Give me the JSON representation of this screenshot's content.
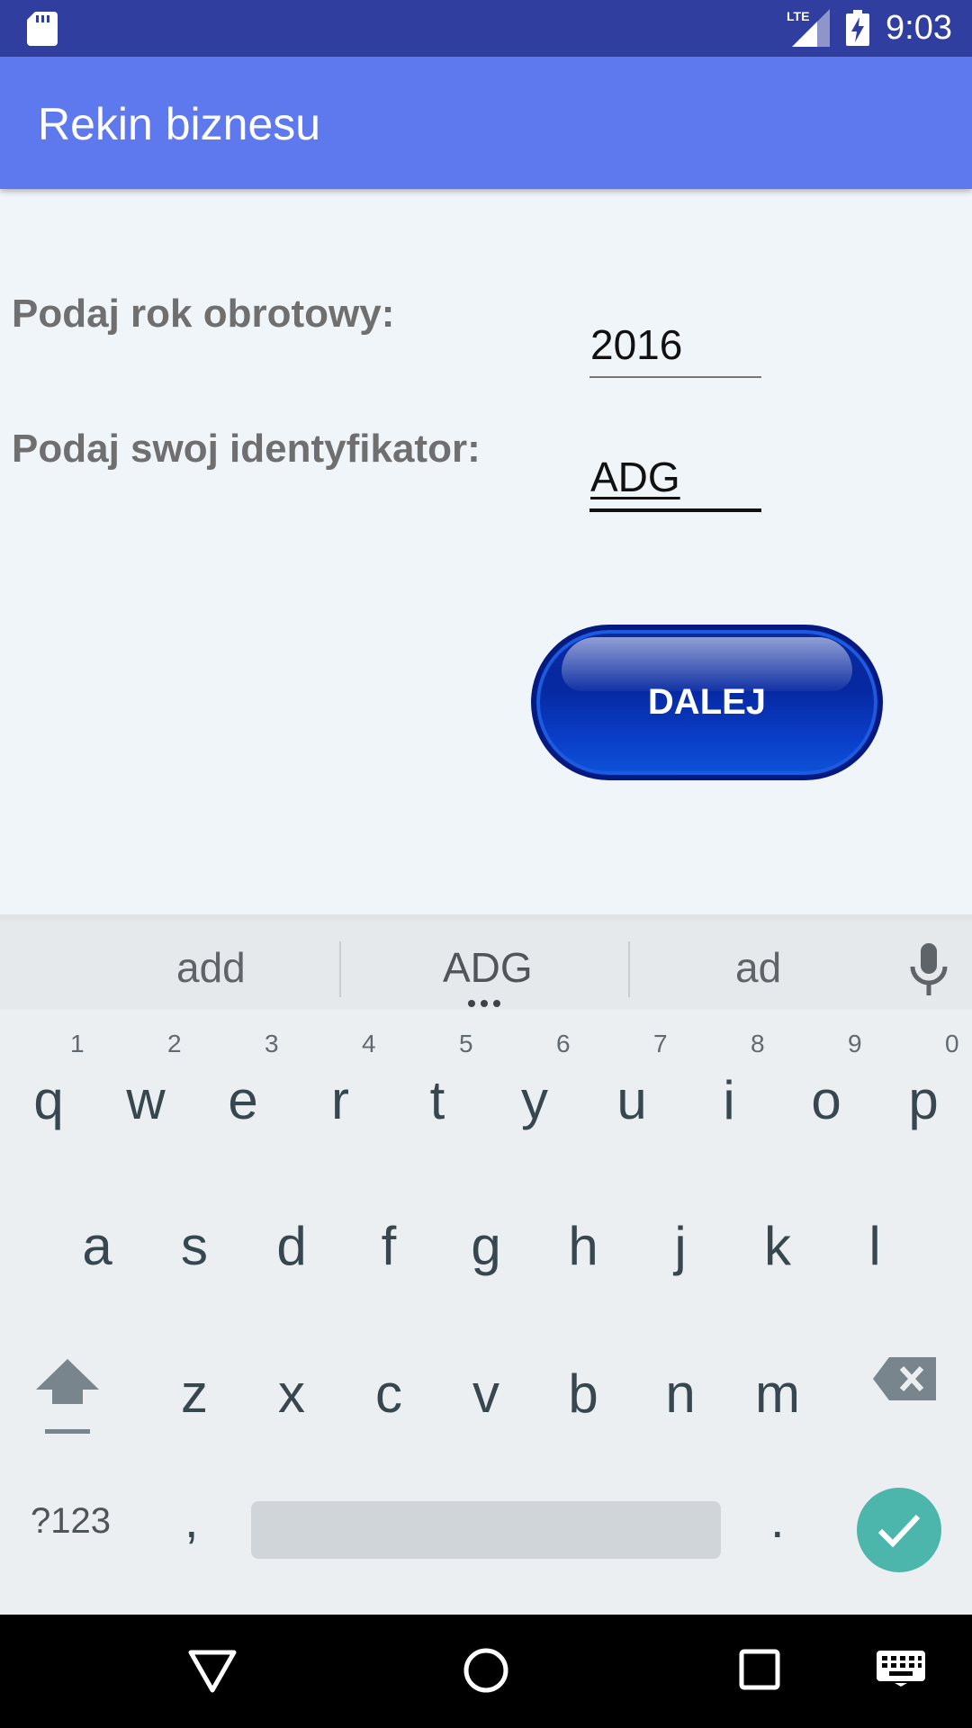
{
  "status_bar": {
    "time": "9:03",
    "network_label": "LTE",
    "icons": [
      "sd-card-icon",
      "lte-signal-icon",
      "battery-charging-icon"
    ]
  },
  "app_bar": {
    "title": "Rekin biznesu"
  },
  "form": {
    "year_label": "Podaj rok obrotowy:",
    "year_value": "2016",
    "id_label": "Podaj swoj identyfikator:",
    "id_value": "ADG",
    "next_button_label": "DALEJ"
  },
  "keyboard": {
    "suggestions": [
      "add",
      "ADG",
      "ad"
    ],
    "row1": [
      {
        "key": "q",
        "hint": "1"
      },
      {
        "key": "w",
        "hint": "2"
      },
      {
        "key": "e",
        "hint": "3"
      },
      {
        "key": "r",
        "hint": "4"
      },
      {
        "key": "t",
        "hint": "5"
      },
      {
        "key": "y",
        "hint": "6"
      },
      {
        "key": "u",
        "hint": "7"
      },
      {
        "key": "i",
        "hint": "8"
      },
      {
        "key": "o",
        "hint": "9"
      },
      {
        "key": "p",
        "hint": "0"
      }
    ],
    "row2": [
      "a",
      "s",
      "d",
      "f",
      "g",
      "h",
      "j",
      "k",
      "l"
    ],
    "row3": [
      "z",
      "x",
      "c",
      "v",
      "b",
      "n",
      "m"
    ],
    "symbols_label": "?123",
    "comma": ",",
    "period": ".",
    "accent_color": "#4db6ac"
  },
  "colors": {
    "status_bar": "#303f9f",
    "app_bar": "#5e78ee",
    "button": "#0a3ec8"
  }
}
